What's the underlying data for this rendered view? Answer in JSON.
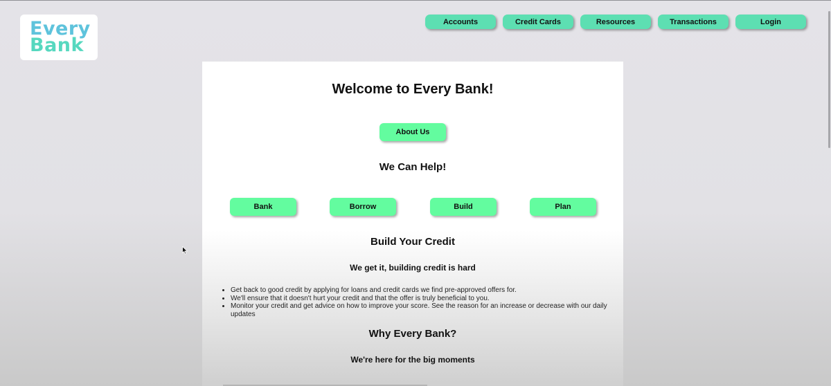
{
  "logo": {
    "line1": "Every",
    "line2": "Bank"
  },
  "nav": {
    "items": [
      "Accounts",
      "Credit Cards",
      "Resources",
      "Transactions",
      "Login"
    ]
  },
  "main": {
    "title": "Welcome to Every Bank!",
    "about_button": "About Us",
    "help_heading": "We Can Help!",
    "help_buttons": [
      "Bank",
      "Borrow",
      "Build",
      "Plan"
    ],
    "credit_heading": "Build Your Credit",
    "credit_subheading": "We get it, building credit is hard",
    "credit_points": [
      "Get back to good credit by applying for loans and credit cards we find pre-approved offers for.",
      "We'll ensure that it doesn't hurt your credit and that the offer is truly beneficial to you.",
      "Monitor your credit and get advice on how to improve your score. See the reason for an increase or decrease with our daily updates"
    ],
    "why_heading": "Why Every Bank?",
    "why_subheading": "We're here for the big moments"
  },
  "colors": {
    "nav_button": "#5ddfb2",
    "action_button": "#63fc9f",
    "logo_blue": "#5ec3dc",
    "logo_teal": "#56d8bf"
  },
  "icons": {
    "cursor": "mouse-pointer-icon"
  }
}
